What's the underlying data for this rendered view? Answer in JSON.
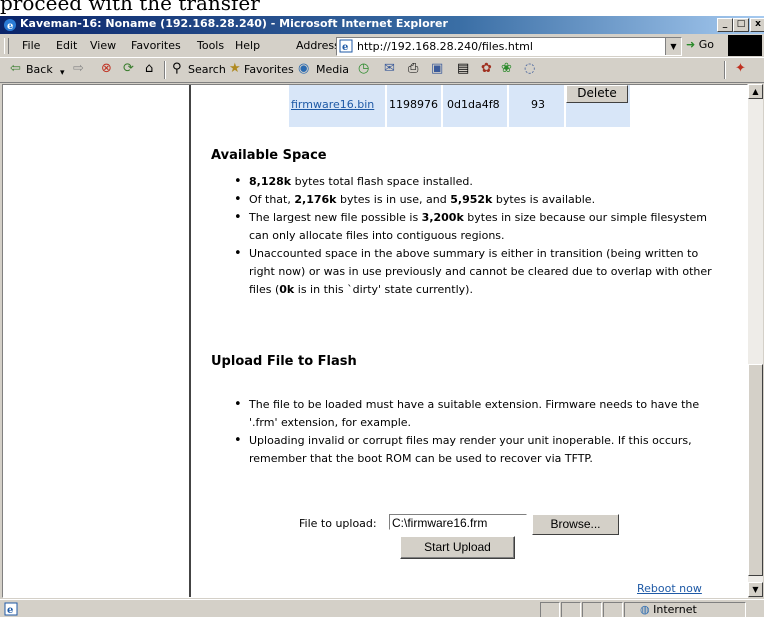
{
  "top_text": "proceed with the transfer",
  "window": {
    "title": "Kaveman-16: Noname (192.168.28.240) - Microsoft Internet Explorer",
    "controls": {
      "minimize": "_",
      "maximize": "□",
      "close": "x"
    }
  },
  "menubar": {
    "items": [
      "File",
      "Edit",
      "View",
      "Favorites",
      "Tools",
      "Help"
    ],
    "address_label": "Address",
    "address_url": "http://192.168.28.240/files.html",
    "go_label": "Go"
  },
  "toolbar": {
    "back": "Back",
    "search": "Search",
    "favorites": "Favorites",
    "media": "Media"
  },
  "file_table": {
    "row": {
      "name": "firmware16.bin",
      "size": "1198976",
      "checksum": "0d1da4f8",
      "count": "93",
      "delete_label": "Delete"
    }
  },
  "available_space": {
    "heading": "Available Space",
    "items": [
      {
        "pre": "",
        "bold": "8,128k",
        "post": " bytes total flash space installed."
      },
      {
        "pre": "Of that, ",
        "bold": "2,176k",
        "mid": " bytes is in use, and ",
        "bold2": "5,952k",
        "post": " bytes is available."
      },
      {
        "pre": "The largest new file possible is ",
        "bold": "3,200k",
        "post": " bytes in size because our simple filesystem can only allocate files into contiguous regions."
      },
      {
        "pre": "Unaccounted space in the above summary is either in transition (being written to right now) or was in use previously and cannot be cleared due to overlap with other files (",
        "bold": "0k",
        "post": " is in this `dirty' state currently)."
      }
    ]
  },
  "upload": {
    "heading": "Upload File to Flash",
    "items": [
      "The file to be loaded must have a suitable extension. Firmware needs to have the '.frm' extension, for example.",
      "Uploading invalid or corrupt files may render your unit inoperable. If this occurs, remember that the boot ROM can be used to recover via TFTP."
    ],
    "file_label": "File to upload:",
    "file_value": "C:\\firmware16.frm",
    "browse_label": "Browse...",
    "start_label": "Start Upload"
  },
  "reboot_label": "Reboot now",
  "status": {
    "zone": "Internet"
  }
}
